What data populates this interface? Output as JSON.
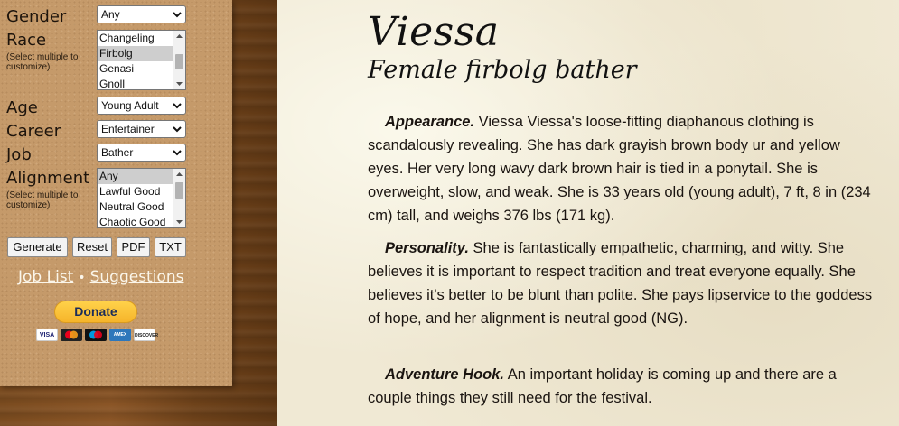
{
  "sidebar": {
    "gender": {
      "label": "Gender",
      "value": "Any"
    },
    "race": {
      "label": "Race",
      "hint": "(Select multiple to customize)",
      "options": [
        "Changeling",
        "Firbolg",
        "Genasi",
        "Gnoll"
      ],
      "selected": "Firbolg"
    },
    "age": {
      "label": "Age",
      "value": "Young Adult"
    },
    "career": {
      "label": "Career",
      "value": "Entertainer"
    },
    "job": {
      "label": "Job",
      "value": "Bather"
    },
    "alignment": {
      "label": "Alignment",
      "hint": "(Select multiple to customize)",
      "options": [
        "Any",
        "Lawful Good",
        "Neutral Good",
        "Chaotic Good"
      ],
      "selected": "Any"
    },
    "buttons": {
      "generate": "Generate",
      "reset": "Reset",
      "pdf": "PDF",
      "txt": "TXT"
    },
    "links": {
      "job_list": "Job List",
      "separator": "•",
      "suggestions": "Suggestions"
    },
    "donate": "Donate",
    "cards": [
      "VISA",
      "MC",
      "MAESTRO",
      "AMEX",
      "DISCOVER"
    ]
  },
  "character": {
    "name": "Viessa",
    "subtitle": "Female firbolg bather",
    "appearance": {
      "heading": "Appearance.",
      "text": "Viessa Viessa's loose-fitting diaphanous clothing is scandalously revealing. She has dark grayish brown body ur and yellow eyes. Her very long wavy dark brown hair is tied in a ponytail. She is overweight, slow, and weak. She is 33 years old (young adult), 7 ft, 8 in (234 cm) tall, and weighs 376 lbs (171 kg)."
    },
    "personality": {
      "heading": "Personality.",
      "text": "She is fantastically empathetic, charming, and witty. She believes it is important to respect tradition and treat everyone equally. She believes it's better to be blunt than polite. She pays lipservice to the goddess of hope, and her alignment is neutral good (NG)."
    },
    "hook": {
      "heading": "Adventure Hook.",
      "text": "An important holiday is coming up and there are a couple things they still need for the festival."
    }
  },
  "colors": {
    "panel": "#c59a6a",
    "parchment": "#f0e9d4",
    "donate": "#f6b42a",
    "link": "#fbf6ea"
  }
}
